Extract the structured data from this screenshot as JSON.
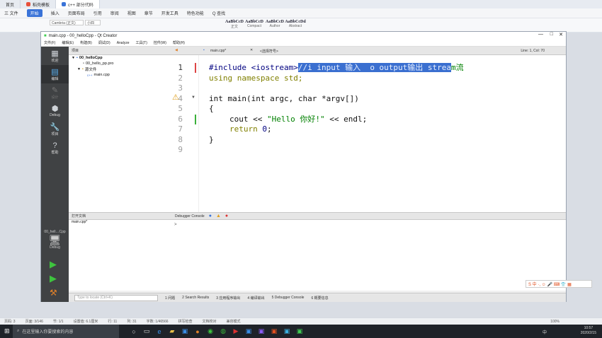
{
  "wps": {
    "tabs": [
      "首页",
      "稻壳模板",
      "c++ 部分代码"
    ],
    "menu": [
      "三 文件",
      "开始",
      "插入",
      "页面布局",
      "引用",
      "审阅",
      "视图",
      "章节",
      "开发工具",
      "特色功能",
      "Q 查找"
    ],
    "font_name": "Cambria (正文)",
    "font_size": "小四",
    "styles": [
      {
        "sample": "AaBbCcD",
        "name": "正文"
      },
      {
        "sample": "AaBbCcD",
        "name": "Compact"
      },
      {
        "sample": "AaBbCcD",
        "name": "Author"
      },
      {
        "sample": "AaBbCcDd",
        "name": "Abstract"
      }
    ],
    "status": [
      "页码: 3",
      "页面: 3/146",
      "节: 1/1",
      "设置值: 6.1厘米",
      "行: 11",
      "列: 31",
      "字数: 1/46566",
      "拼写检查",
      "文档校对",
      "兼容模式"
    ],
    "zoom": "100%"
  },
  "qt": {
    "title": "main.cpp - 00_helloCpp - Qt Creator",
    "menu": [
      "文件(F)",
      "编辑(E)",
      "构建(B)",
      "调试(D)",
      "Analyze",
      "工具(T)",
      "控件(W)",
      "帮助(H)"
    ],
    "modes": [
      {
        "icon": "▦",
        "label": "欢迎"
      },
      {
        "icon": "▤",
        "label": "编辑"
      },
      {
        "icon": "✎",
        "label": "设计"
      },
      {
        "icon": "⬢",
        "label": "Debug"
      },
      {
        "icon": "🔧",
        "label": "项目"
      },
      {
        "icon": "?",
        "label": "帮助"
      }
    ],
    "kit": {
      "project": "00_hell…Cpp",
      "config": "Debug"
    },
    "sidebar_title": "项目",
    "tree": [
      {
        "label": "00_helloCpp",
        "indent": 0
      },
      {
        "label": "00_hello_pp.pro",
        "indent": 1
      },
      {
        "label": "源文件",
        "indent": 1
      },
      {
        "label": "main.cpp",
        "indent": 2
      }
    ],
    "open_files_title": "打开文档",
    "open_files": [
      "main.cpp*"
    ],
    "editor_tab": "main.cpp*",
    "editor_symbol": "<选择符号>",
    "editor_pos": "Line: 1, Col: 70",
    "line_numbers": [
      "1",
      "2",
      "3",
      "4",
      "5",
      "6",
      "7",
      "8",
      "9"
    ],
    "code": {
      "l1_pre": "#include <iostream>",
      "l1_sel": "//i input 输入  o output输出 strea",
      "l1_post": "m流",
      "l2": "using namespace std;",
      "l4a": "int main(int argc, char *argv[])",
      "l5": "{",
      "l6_a": "cout << ",
      "l6_str": "\"Hello 你好!\"",
      "l6_b": " << endl;",
      "l7_a": "return ",
      "l7_num": "0",
      "l7_b": ";",
      "l8": "}"
    },
    "debug_console_title": "Debugger Console",
    "debug_prompt": ">",
    "status_tabs": [
      "1 问题",
      "2 Search Results",
      "3 应用程序输出",
      "4 编译输出",
      "5 Debugger Console",
      "6 概要信息"
    ],
    "locator_placeholder": "Type to locate (Ctrl+K)"
  },
  "taskbar": {
    "search_placeholder": "在这里输入你要搜索的内容",
    "time": "10:57",
    "date": "2020/2/15",
    "lang": "中"
  },
  "ime": {
    "label": "S 中 ·, ☺ 🎤 ⌨ 👕 ▦"
  }
}
